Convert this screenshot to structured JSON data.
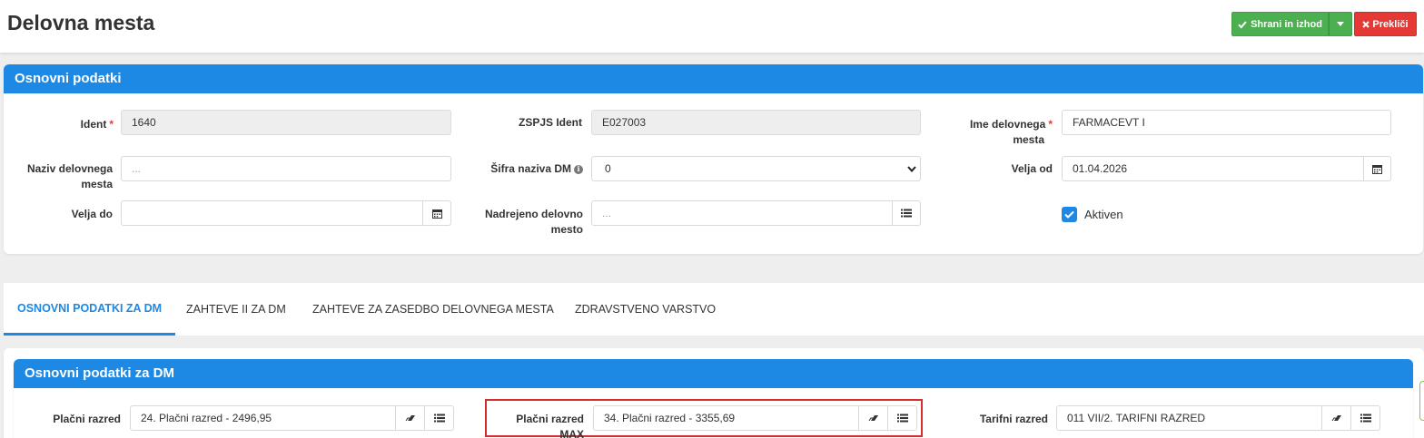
{
  "header": {
    "title": "Delovna mesta",
    "save_label": "Shrani in izhod",
    "cancel_label": "Prekliči"
  },
  "basic_panel": {
    "title": "Osnovni podatki",
    "ident_label": "Ident",
    "ident_value": "1640",
    "zspjs_label": "ZSPJS Ident",
    "zspjs_value": "E027003",
    "ime_label_1": "Ime delovnega",
    "ime_label_2": "mesta",
    "ime_value": "FARMACEVT I",
    "naziv_label_1": "Naziv delovnega",
    "naziv_label_2": "mesta",
    "naziv_placeholder": "...",
    "sifra_label": "Šifra naziva DM",
    "sifra_value": "0",
    "velja_od_label": "Velja od",
    "velja_od_value": "01.04.2026",
    "velja_do_label": "Velja do",
    "nadrejeno_label_1": "Nadrejeno delovno",
    "nadrejeno_label_2": "mesto",
    "nadrejeno_placeholder": "...",
    "aktiven_label": "Aktiven",
    "aktiven_checked": true
  },
  "tabs": [
    {
      "label": "OSNOVNI PODATKI ZA DM",
      "active": true
    },
    {
      "label": "ZAHTEVE II ZA DM",
      "active": false
    },
    {
      "label": "ZAHTEVE ZA ZASEDBO DELOVNEGA MESTA",
      "active": false
    },
    {
      "label": "ZDRAVSTVENO VARSTVO",
      "active": false
    }
  ],
  "dm_panel": {
    "title": "Osnovni podatki za DM",
    "placni_label": "Plačni razred",
    "placni_value": "24. Plačni razred - 2496,95",
    "placni_max_label": "Plačni razred MAX",
    "placni_max_value": "34. Plačni razred - 3355,69",
    "tarifni_label": "Tarifni razred",
    "tarifni_value": "011 VII/2. TARIFNI RAZRED"
  },
  "colors": {
    "accent": "#1e88e5",
    "save": "#4caf50",
    "cancel": "#e53935",
    "highlight": "#d32f2f"
  }
}
